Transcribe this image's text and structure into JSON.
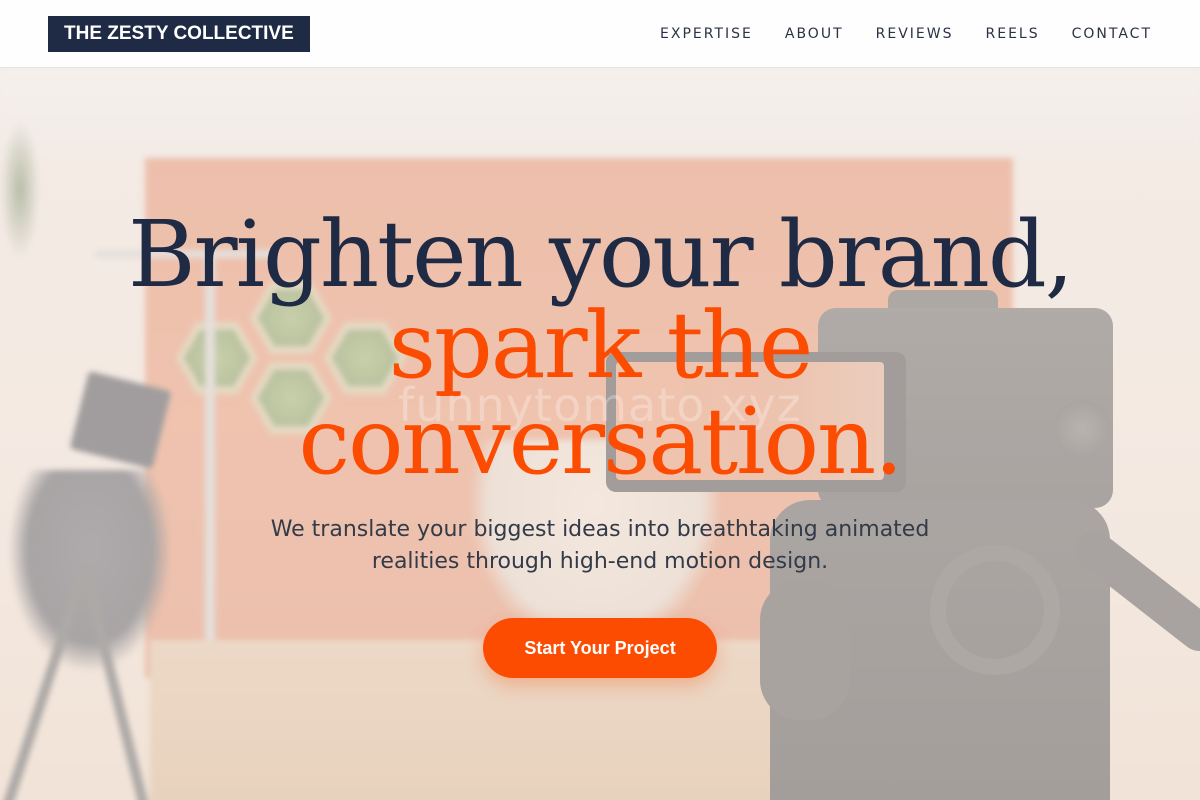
{
  "header": {
    "logo": "THE ZESTY COLLECTIVE",
    "nav": [
      {
        "label": "EXPERTISE"
      },
      {
        "label": "ABOUT"
      },
      {
        "label": "REVIEWS"
      },
      {
        "label": "REELS"
      },
      {
        "label": "CONTACT"
      }
    ]
  },
  "hero": {
    "headline_line1": "Brighten your brand,",
    "headline_line2": "spark the",
    "headline_line3": "conversation.",
    "watermark": "funnytomato.xyz",
    "subtext": "We translate your biggest ideas into breathtaking animated realities through high-end motion design.",
    "cta_label": "Start Your Project"
  },
  "colors": {
    "navy": "#1f2a44",
    "accent_orange": "#fc4c02",
    "header_bg": "#ffffff"
  }
}
